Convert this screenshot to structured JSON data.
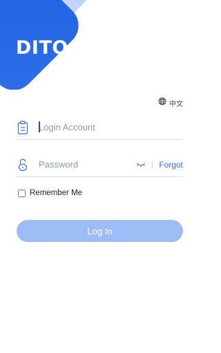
{
  "brand": {
    "logo_text": "DITO",
    "primary_color": "#2f6ee8",
    "light_color": "#b9cdf8"
  },
  "language": {
    "label": "中文",
    "icon": "globe-icon"
  },
  "account": {
    "placeholder": "Login Account",
    "value": "",
    "icon": "id-card-icon"
  },
  "password": {
    "placeholder": "Password",
    "value": "",
    "icon": "lock-open-icon",
    "toggle_icon": "eye-closed-icon",
    "forgot_label": "Forgot"
  },
  "remember": {
    "label": "Remember Me",
    "checked": false
  },
  "login": {
    "label": "Log In",
    "disabled": true
  }
}
